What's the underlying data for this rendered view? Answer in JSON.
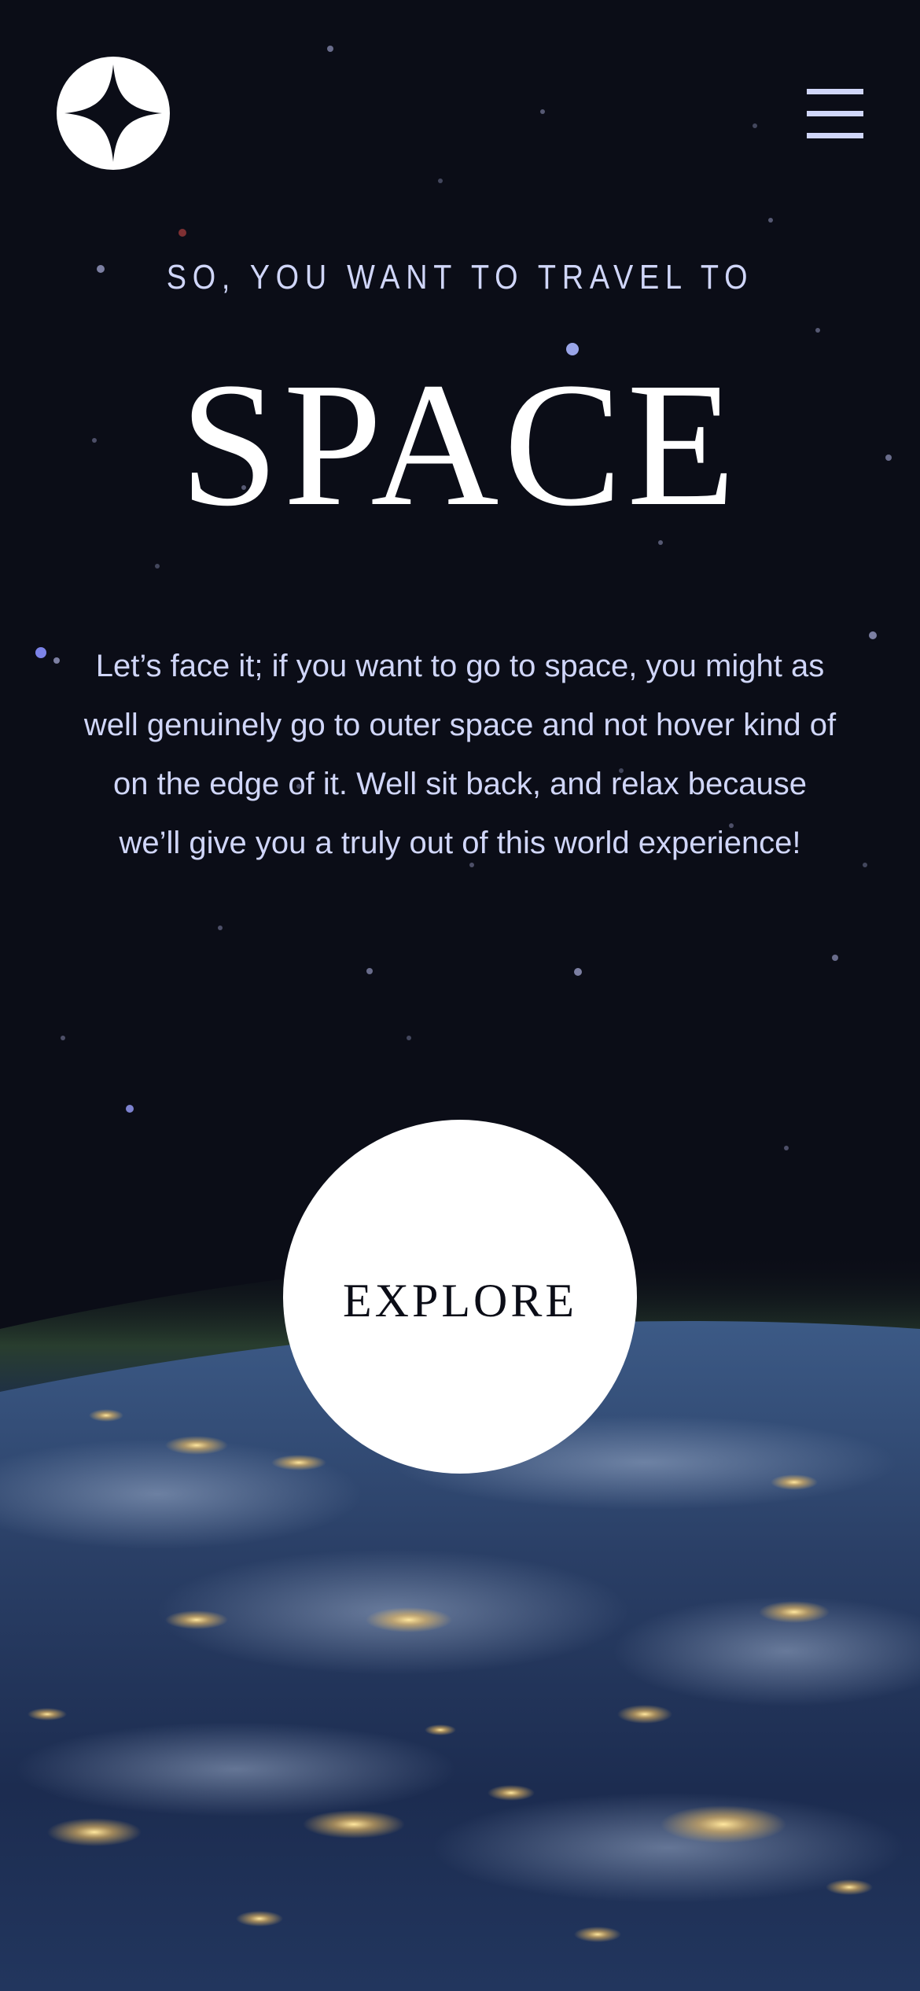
{
  "header": {
    "logo_icon": "star-logo-icon",
    "menu_icon": "hamburger-menu-icon"
  },
  "hero": {
    "eyebrow": "SO, YOU WANT TO TRAVEL TO",
    "title": "SPACE",
    "description": "Let’s face it; if you want to go to space, you might as well genuinely go to outer space and not hover kind of on the edge of it. Well sit back, and relax because we’ll give you a truly out of this world experience!"
  },
  "cta": {
    "explore_label": "EXPLORE"
  },
  "colors": {
    "background": "#0b0d17",
    "text_light": "#d0d6f9",
    "white": "#ffffff"
  }
}
